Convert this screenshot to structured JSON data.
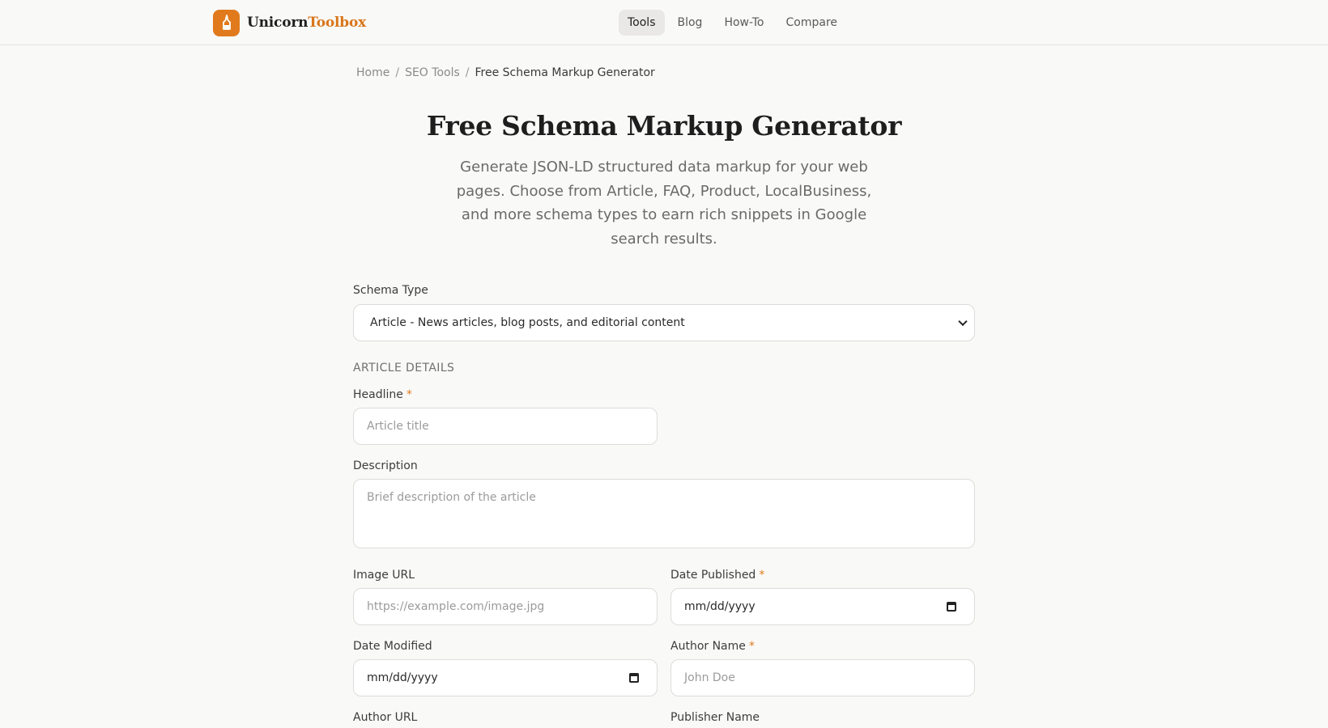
{
  "brand": {
    "name_part1": "Unicorn",
    "name_part2": "Toolbox",
    "accent": "#e07a1c"
  },
  "nav": {
    "items": [
      {
        "label": "Tools",
        "active": true
      },
      {
        "label": "Blog"
      },
      {
        "label": "How-To"
      },
      {
        "label": "Compare"
      }
    ]
  },
  "breadcrumb": {
    "items": [
      "Home",
      "SEO Tools",
      "Free Schema Markup Generator"
    ],
    "separator": "/"
  },
  "page": {
    "title": "Free Schema Markup Generator",
    "description": "Generate JSON-LD structured data markup for your web pages. Choose from Article, FAQ, Product, LocalBusiness, and more schema types to earn rich snippets in Google search results."
  },
  "form": {
    "schema_type": {
      "label": "Schema Type",
      "selected": "Article - News articles, blog posts, and editorial content"
    },
    "section_title": "ARTICLE DETAILS",
    "required_marker": "*",
    "fields": {
      "headline": {
        "label": "Headline",
        "placeholder": "Article title"
      },
      "description": {
        "label": "Description",
        "placeholder": "Brief description of the article"
      },
      "image_url": {
        "label": "Image URL",
        "placeholder": "https://example.com/image.jpg"
      },
      "date_published": {
        "label": "Date Published",
        "value": "mm/dd/yyyy"
      },
      "date_modified": {
        "label": "Date Modified",
        "value": "mm/dd/yyyy"
      },
      "author_name": {
        "label": "Author Name",
        "placeholder": "John Doe"
      },
      "author_url": {
        "label": "Author URL"
      },
      "publisher_name": {
        "label": "Publisher Name"
      }
    }
  }
}
